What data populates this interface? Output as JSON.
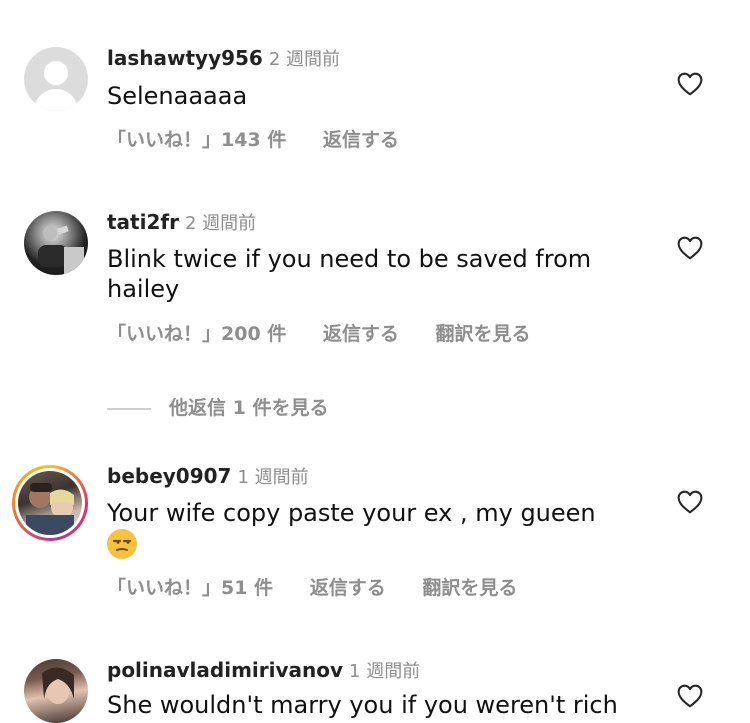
{
  "comments": [
    {
      "username": "lashawtyy956",
      "time": "2 週間前",
      "text": "Selenaaaaa",
      "likes": "「いいね！」143 件",
      "reply": "返信する"
    },
    {
      "username": "tati2fr",
      "time": "2 週間前",
      "text": "Blink twice if you need to be saved from hailey",
      "likes": "「いいね！」200 件",
      "reply": "返信する",
      "translate": "翻訳を見る",
      "more_replies": "他返信 1 件を見る"
    },
    {
      "username": "bebey0907",
      "time": "1 週間前",
      "text": "Your wife copy paste your ex , my gueen",
      "emoji": "unamused-face",
      "likes": "「いいね！」51 件",
      "reply": "返信する",
      "translate": "翻訳を見る"
    },
    {
      "username": "polinavladimirivanov",
      "time": "1 週間前",
      "text": "She wouldn't marry you if you weren't rich"
    }
  ],
  "colors": {
    "secondary_text": "#8e8e8e",
    "ring_gradient": [
      "#f5c518",
      "#e1306c"
    ]
  }
}
